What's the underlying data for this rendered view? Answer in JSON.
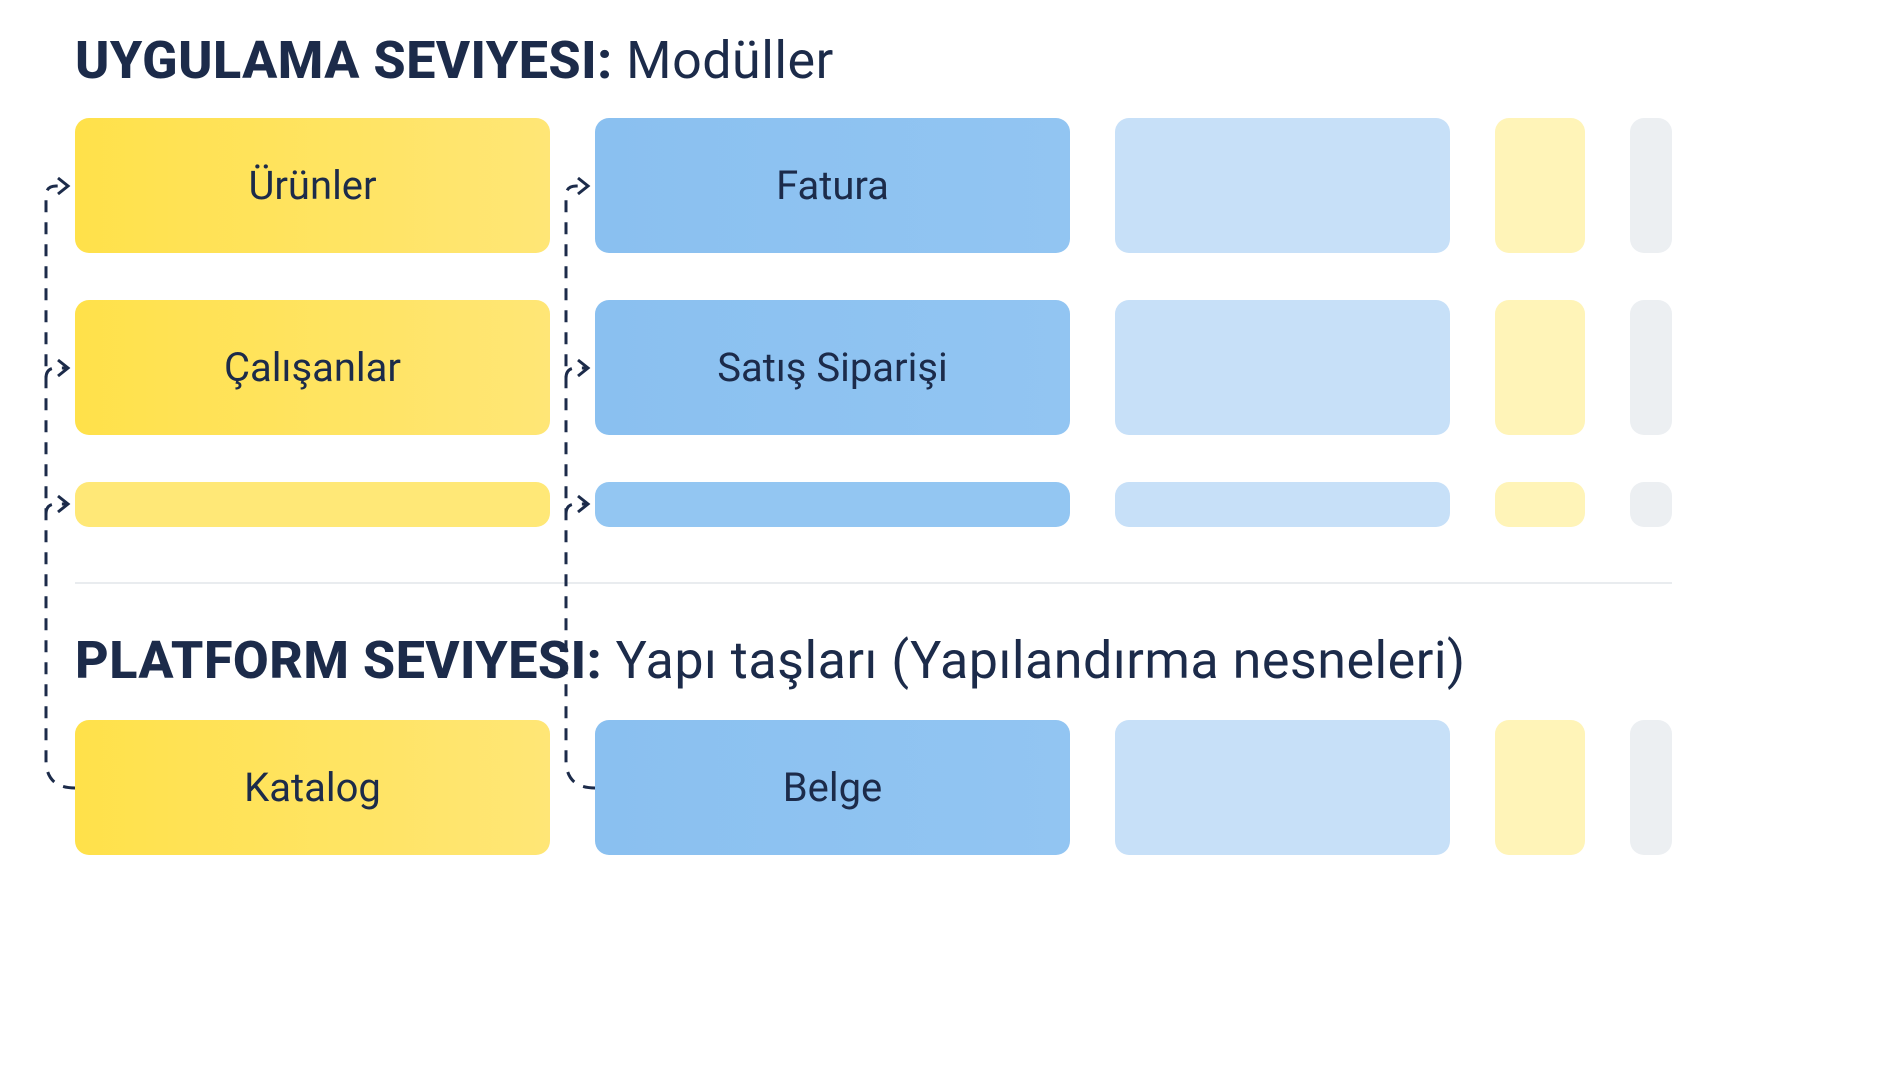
{
  "sections": {
    "app": {
      "title_bold": "UYGULAMA SEVIYESI:",
      "title_light": "Modüller"
    },
    "platform": {
      "title_bold": "PLATFORM SEVIYESI:",
      "title_light": "Yapı taşları (Yapılandırma nesneleri)"
    }
  },
  "app_modules": {
    "yellow": {
      "row1": "Ürünler",
      "row2": "Çalışanlar",
      "row3": ""
    },
    "blue": {
      "row1": "Fatura",
      "row2": "Satış Siparişi",
      "row3": ""
    }
  },
  "platform_blocks": {
    "yellow": "Katalog",
    "blue": "Belge"
  }
}
